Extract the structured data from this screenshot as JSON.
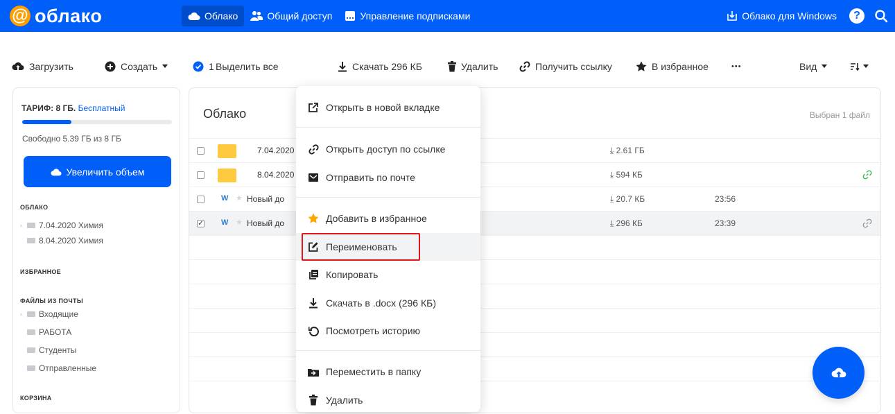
{
  "app": {
    "logo_symbol": "@",
    "logo_text": "облако",
    "brand_color": "#005ff9",
    "accent_orange": "#ff9e00"
  },
  "topnav": {
    "items": [
      {
        "label": "Облако",
        "icon": "cloud-icon",
        "active": true
      },
      {
        "label": "Общий доступ",
        "icon": "users-icon",
        "active": false
      },
      {
        "label": "Управление подписками",
        "icon": "subscription-icon",
        "active": false
      }
    ],
    "windows_link": "Облако для Windows",
    "help_symbol": "?"
  },
  "toolbar": {
    "upload": "Загрузить",
    "create": "Создать",
    "selected_count": "1",
    "select_all": "Выделить все",
    "download": "Скачать 296 КБ",
    "delete": "Удалить",
    "get_link": "Получить ссылку",
    "favorite": "В избранное",
    "more": "•••",
    "view": "Вид"
  },
  "sidebar": {
    "tariff_label": "ТАРИФ: 8 ГБ.",
    "tariff_link": "Бесплатный",
    "storage_used_fraction": 0.33,
    "free_text": "Свободно 5.39 ГБ из 8 ГБ",
    "increase_button": "Увеличить объем",
    "sections": {
      "cloud": "ОБЛАКО",
      "favorites": "ИЗБРАННОЕ",
      "mail_files": "ФАЙЛЫ ИЗ ПОЧТЫ",
      "trash": "КОРЗИНА"
    },
    "cloud_items": [
      "7.04.2020 Химия",
      "8.04.2020 Химия"
    ],
    "mail_items": [
      "Входящие",
      "РАБОТА",
      "Студенты",
      "Отправленные"
    ]
  },
  "main": {
    "title": "Облако",
    "selected_info": "Выбран 1 файл",
    "files": [
      {
        "name": "7.04.2020",
        "type": "folder",
        "size": "2.61 ГБ",
        "time": "",
        "checked": false,
        "shared": false
      },
      {
        "name": "8.04.2020",
        "type": "folder",
        "size": "594 КБ",
        "time": "",
        "checked": false,
        "shared": true
      },
      {
        "name": "Новый до",
        "type": "word",
        "size": "20.7 КБ",
        "time": "23:56",
        "checked": false,
        "shared": false
      },
      {
        "name": "Новый до",
        "type": "word",
        "size": "296 КБ",
        "time": "23:39",
        "checked": true,
        "shared": true
      }
    ],
    "size_prefix": "⤓",
    "check_mark": "✓",
    "word_letter": "W",
    "star_glyph": "★"
  },
  "context_menu": {
    "open_new_tab": "Открыть в новой вкладке",
    "share_link": "Открыть доступ по ссылке",
    "send_mail": "Отправить по почте",
    "add_favorite": "Добавить в избранное",
    "rename": "Переименовать",
    "copy": "Копировать",
    "download_docx": "Скачать в .docx (296 КБ)",
    "history": "Посмотреть историю",
    "move": "Переместить в папку",
    "delete": "Удалить",
    "highlight_color": "#e5151c"
  }
}
